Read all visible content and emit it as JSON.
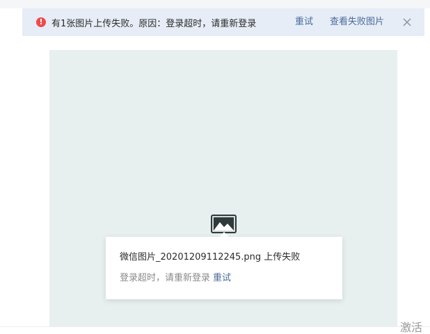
{
  "alert": {
    "icon": "error-icon",
    "icon_glyph": "!",
    "message": "有1张图片上传失败。原因：登录超时，请重新登录",
    "retry_label": "重试",
    "view_failed_label": "查看失败图片",
    "close_icon": "close-icon"
  },
  "preview": {
    "placeholder_icon": "image-placeholder-icon"
  },
  "popover": {
    "file_line": "微信图片_20201209112245.png 上传失败",
    "reason": "登录超时，请重新登录",
    "retry_label": "重试"
  },
  "watermark": {
    "text": "激活"
  },
  "colors": {
    "alert_bg": "#e6edf6",
    "error": "#ef4b4b",
    "link": "#4a6a9b",
    "canvas_bg": "#e7f0ef"
  }
}
